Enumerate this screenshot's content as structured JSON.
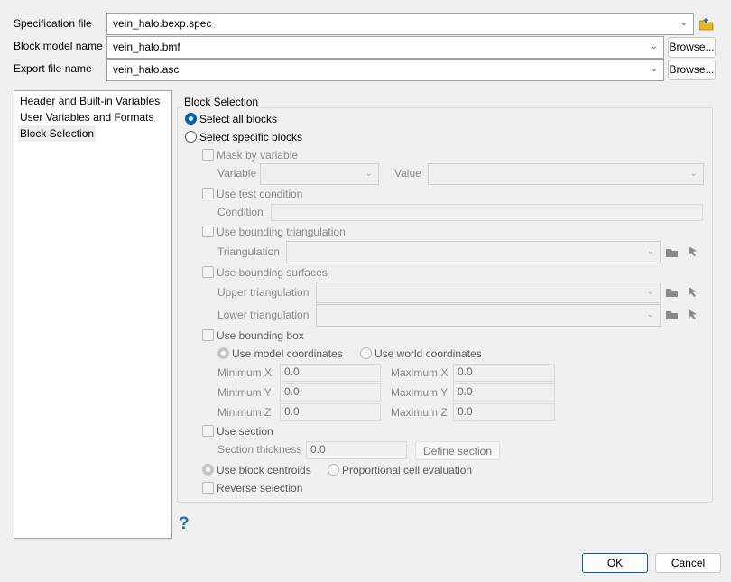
{
  "fields": {
    "spec_label": "Specification file",
    "spec_value": "vein_halo.bexp.spec",
    "model_label": "Block model name",
    "model_value": "vein_halo.bmf",
    "export_label": "Export file name",
    "export_value": "vein_halo.asc",
    "browse": "Browse..."
  },
  "nav": {
    "items": [
      {
        "label": "Header and Built-in Variables"
      },
      {
        "label": "User Variables and Formats"
      },
      {
        "label": "Block Selection",
        "selected": true
      }
    ]
  },
  "group": {
    "title": "Block Selection",
    "select_all": "Select all blocks",
    "select_specific": "Select specific blocks",
    "mask": "Mask by variable",
    "variable": "Variable",
    "value": "Value",
    "test": "Use test condition",
    "condition": "Condition",
    "bound_tri": "Use bounding triangulation",
    "triangulation": "Triangulation",
    "bound_surf": "Use bounding surfaces",
    "upper": "Upper triangulation",
    "lower": "Lower triangulation",
    "bbox": "Use bounding box",
    "model_coords": "Use model coordinates",
    "world_coords": "Use world coordinates",
    "minx": "Minimum X",
    "maxx": "Maximum X",
    "miny": "Minimum Y",
    "maxy": "Maximum Y",
    "minz": "Minimum Z",
    "maxz": "Maximum Z",
    "minx_v": "0.0",
    "maxx_v": "0.0",
    "miny_v": "0.0",
    "maxy_v": "0.0",
    "minz_v": "0.0",
    "maxz_v": "0.0",
    "section": "Use section",
    "thickness": "Section thickness",
    "thickness_v": "0.0",
    "define": "Define section",
    "centroids": "Use block centroids",
    "proportional": "Proportional cell evaluation",
    "reverse": "Reverse selection"
  },
  "help": "?",
  "ok": "OK",
  "cancel": "Cancel",
  "colors": {
    "accent": "#005fb8",
    "folder": "#e8b923"
  }
}
